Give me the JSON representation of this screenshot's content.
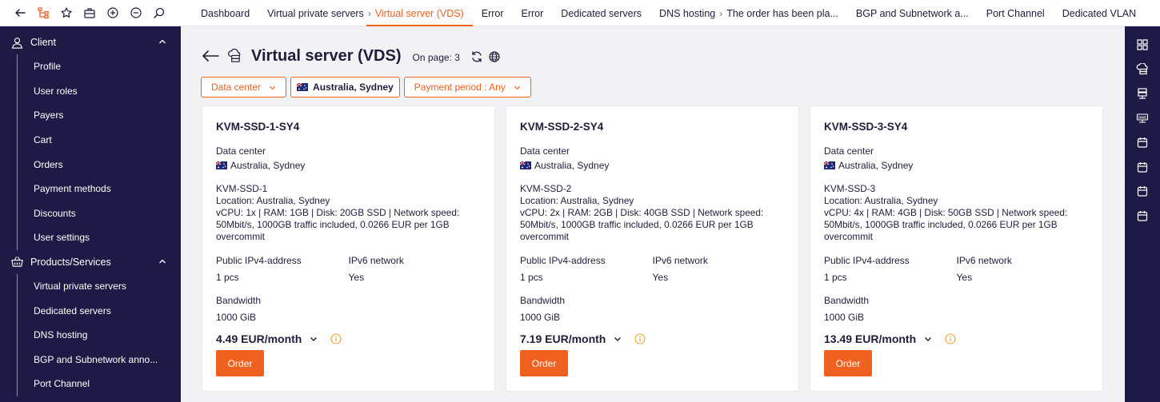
{
  "topbar": {
    "icons": [
      "back-arrow-icon",
      "tree-icon",
      "star-icon",
      "briefcase-icon",
      "zoom-in-icon",
      "zoom-out-icon",
      "search-icon"
    ],
    "tabs": [
      {
        "label": "Dashboard",
        "sep": false
      },
      {
        "label": "Virtual private servers",
        "sep": true
      },
      {
        "label": "Virtual server (VDS)",
        "sep": false,
        "active": true
      },
      {
        "label": "Error",
        "sep": false
      },
      {
        "label": "Error",
        "sep": false
      },
      {
        "label": "Dedicated servers",
        "sep": false
      },
      {
        "label": "DNS hosting",
        "sep": true
      },
      {
        "label": "The order has been pla...",
        "sep": false
      },
      {
        "label": "BGP and Subnetwork a...",
        "sep": false
      },
      {
        "label": "Port Channel",
        "sep": false
      },
      {
        "label": "Dedicated VLAN",
        "sep": false
      }
    ],
    "sep_glyph": "›"
  },
  "sidebar": {
    "client": {
      "label": "Client",
      "items": [
        "Profile",
        "User roles",
        "Payers",
        "Cart",
        "Orders",
        "Payment methods",
        "Discounts",
        "User settings"
      ]
    },
    "products": {
      "label": "Products/Services",
      "items": [
        "Virtual private servers",
        "Dedicated servers",
        "DNS hosting",
        "BGP and Subnetwork anno...",
        "Port Channel"
      ]
    }
  },
  "header": {
    "title": "Virtual server (VDS)",
    "on_page": "On page: 3"
  },
  "filters": {
    "data_center": "Data center",
    "location_chip": "Australia, Sydney",
    "payment_period": "Payment period : Any"
  },
  "cards": [
    {
      "title": "KVM-SSD-1-SY4",
      "dc_label": "Data center",
      "dc_value": "Australia, Sydney",
      "desc_name": "KVM-SSD-1",
      "desc_location": "Location: Australia, Sydney",
      "desc_specs": "vCPU: 1x | RAM: 1GB | Disk: 20GB SSD | Network speed: 50Mbit/s, 1000GB traffic included, 0.0266 EUR per 1GB overcommit",
      "ipv4_label": "Public IPv4-address",
      "ipv4_value": "1 pcs",
      "ipv6_label": "IPv6 network",
      "ipv6_value": "Yes",
      "bw_label": "Bandwidth",
      "bw_value": "1000 GiB",
      "price": "4.49 EUR/month",
      "order": "Order"
    },
    {
      "title": "KVM-SSD-2-SY4",
      "dc_label": "Data center",
      "dc_value": "Australia, Sydney",
      "desc_name": "KVM-SSD-2",
      "desc_location": "Location: Australia, Sydney",
      "desc_specs": "vCPU: 2x | RAM: 2GB | Disk: 40GB SSD | Network speed: 50Mbit/s, 1000GB traffic included, 0.0266 EUR per 1GB overcommit",
      "ipv4_label": "Public IPv4-address",
      "ipv4_value": "1 pcs",
      "ipv6_label": "IPv6 network",
      "ipv6_value": "Yes",
      "bw_label": "Bandwidth",
      "bw_value": "1000 GiB",
      "price": "7.19 EUR/month",
      "order": "Order"
    },
    {
      "title": "KVM-SSD-3-SY4",
      "dc_label": "Data center",
      "dc_value": "Australia, Sydney",
      "desc_name": "KVM-SSD-3",
      "desc_location": "Location: Australia, Sydney",
      "desc_specs": "vCPU: 4x | RAM: 4GB | Disk: 50GB SSD | Network speed: 50Mbit/s, 1000GB traffic included, 0.0266 EUR per 1GB overcommit",
      "ipv4_label": "Public IPv4-address",
      "ipv4_value": "1 pcs",
      "ipv6_label": "IPv6 network",
      "ipv6_value": "Yes",
      "bw_label": "Bandwidth",
      "bw_value": "1000 GiB",
      "price": "13.49 EUR/month",
      "order": "Order"
    }
  ],
  "rail": {
    "icons": [
      "grid-icon",
      "cloud-server-icon",
      "server-stack-icon",
      "dns-icon",
      "calendar-icon",
      "calendar-icon",
      "calendar-icon",
      "calendar-icon"
    ]
  },
  "colors": {
    "accent": "#f0601e",
    "sidebar": "#1d1a45",
    "text": "#1e1e3c",
    "background": "#f2f2f5"
  }
}
